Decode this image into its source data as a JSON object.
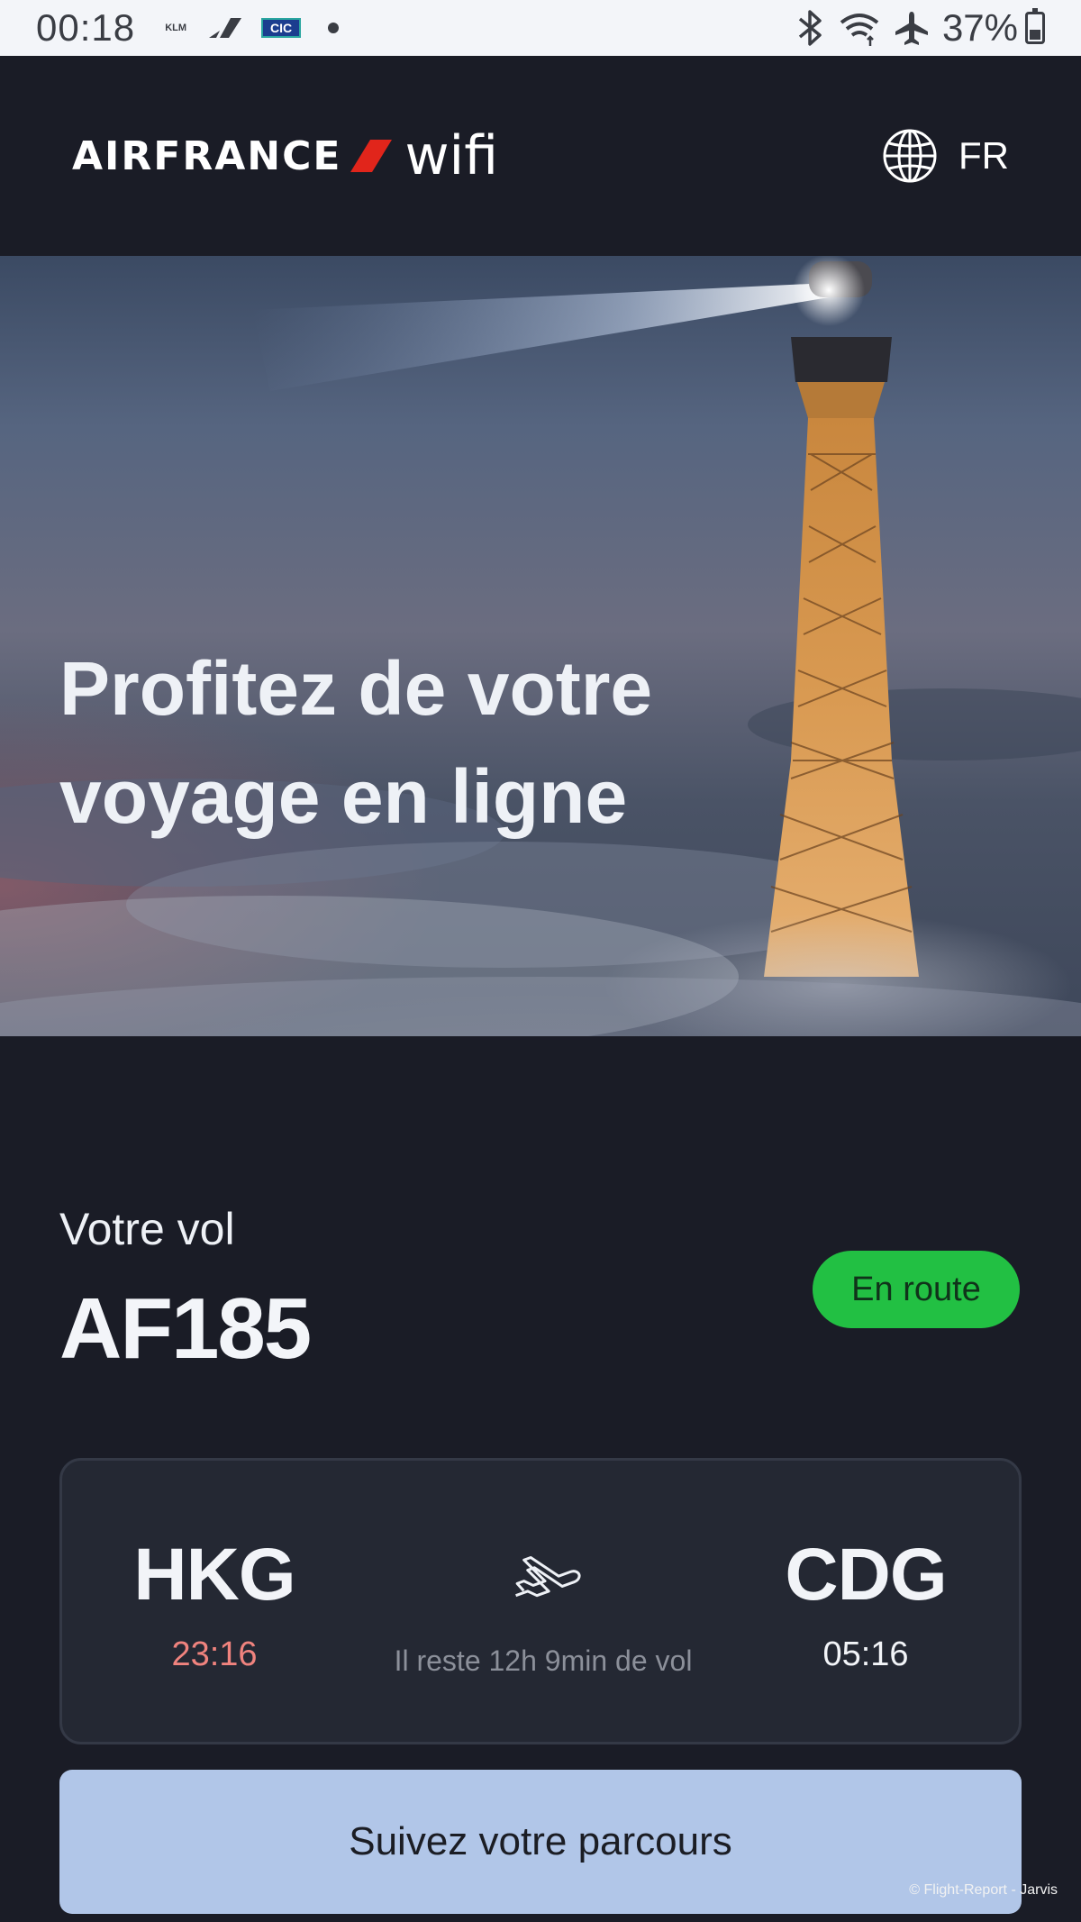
{
  "status_bar": {
    "time": "00:18",
    "notification_icons": [
      "klm-icon",
      "slash-logo-icon",
      "cic-icon",
      "dot-icon"
    ],
    "klm_label": "KLM",
    "cic_label": "CIC",
    "right_icons": [
      "bluetooth-icon",
      "wifi-icon",
      "airplane-mode-icon"
    ],
    "battery_percent": "37%",
    "battery_level": 0.37
  },
  "header": {
    "brand": "AIRFRANCE",
    "product": "wifi",
    "brand_accent_color": "#e1251b",
    "language_icon": "globe-icon",
    "language": "FR"
  },
  "hero": {
    "title": "Profitez de votre voyage en ligne"
  },
  "flight": {
    "label": "Votre vol",
    "number": "AF185",
    "status": "En route",
    "status_color": "#22c043",
    "origin": {
      "code": "HKG",
      "time": "23:16"
    },
    "destination": {
      "code": "CDG",
      "time": "05:16"
    },
    "route_icon": "airplane-icon",
    "remaining": "Il reste 12h 9min de vol"
  },
  "track_button": {
    "label": "Suivez votre parcours"
  },
  "watermark": "© Flight-Report - Jarvis"
}
